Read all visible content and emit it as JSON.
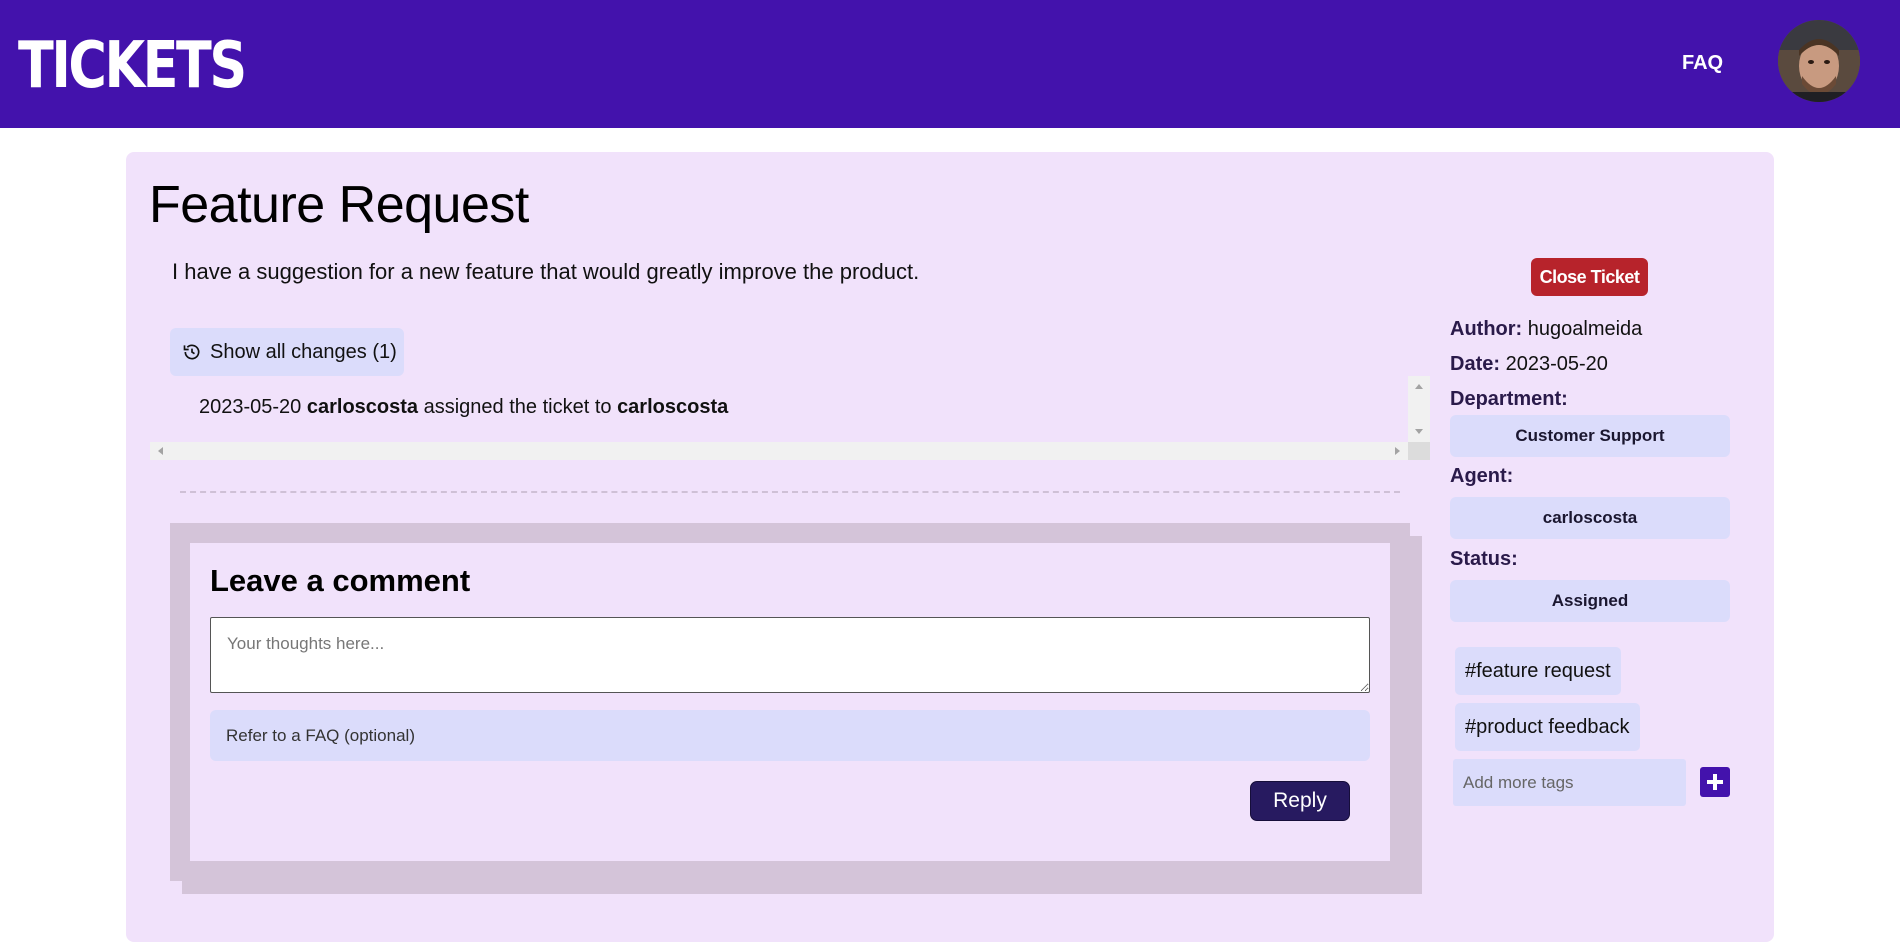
{
  "header": {
    "logo": "TICKETS",
    "faq_label": "FAQ",
    "avatar_icon": "user-avatar-icon"
  },
  "ticket": {
    "title": "Feature Request",
    "description": "I have a suggestion for a new feature that would greatly improve the product.",
    "history_button_label": "Show all changes (1)",
    "history_icon": "history-icon",
    "changes": [
      {
        "date": "2023-05-20",
        "actor": "carloscosta",
        "action": "assigned the ticket to",
        "target": "carloscosta"
      }
    ]
  },
  "comment": {
    "title": "Leave a comment",
    "placeholder": "Your thoughts here...",
    "faq_placeholder": "Refer to a FAQ (optional)",
    "reply_label": "Reply"
  },
  "sidebar": {
    "close_label": "Close Ticket",
    "author_label": "Author:",
    "author": "hugoalmeida",
    "date_label": "Date:",
    "date": "2023-05-20",
    "department_label": "Department:",
    "department": "Customer Support",
    "agent_label": "Agent:",
    "agent": "carloscosta",
    "status_label": "Status:",
    "status": "Assigned",
    "tags": [
      "#feature request",
      "#product feedback"
    ],
    "tag_placeholder": "Add more tags",
    "add_tag_icon": "plus-icon"
  },
  "colors": {
    "header": "#4312ac",
    "card": "#f1e2fb",
    "pill": "#dbdcfb",
    "close": "#b7232b",
    "reply": "#271a60"
  }
}
